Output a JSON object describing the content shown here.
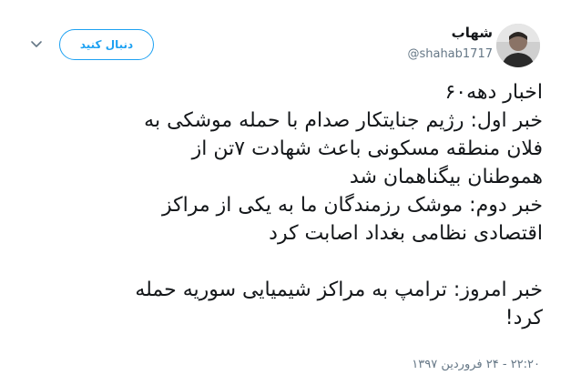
{
  "author": {
    "display_name": "شهاب",
    "handle": "@shahab1717"
  },
  "follow_button_label": "دنبال کنید",
  "tweet": {
    "lines": [
      "اخبار دهه۶۰",
      "خبر اول: رژیم جنایتکار صدام با حمله موشکی به",
      "فلان منطقه مسکونی باعث شهادت ۷تن از",
      "هموطنان بیگناهمان شد",
      "خبر دوم: موشک رزمندگان ما به یکی از مراکز",
      "اقتصادی نظامی بغداد اصابت کرد",
      "",
      "خبر امروز: ترامپ به مراکز شیمیایی سوریه حمله",
      "کرد!"
    ],
    "timestamp": "۲۲:۲۰ - ۲۴ فروردین ۱۳۹۷"
  },
  "icons": {
    "more": "chevron-down-icon",
    "avatar": "profile-photo"
  },
  "colors": {
    "accent": "#1da1f2",
    "secondary_text": "#657786",
    "primary_text": "#14171a"
  }
}
